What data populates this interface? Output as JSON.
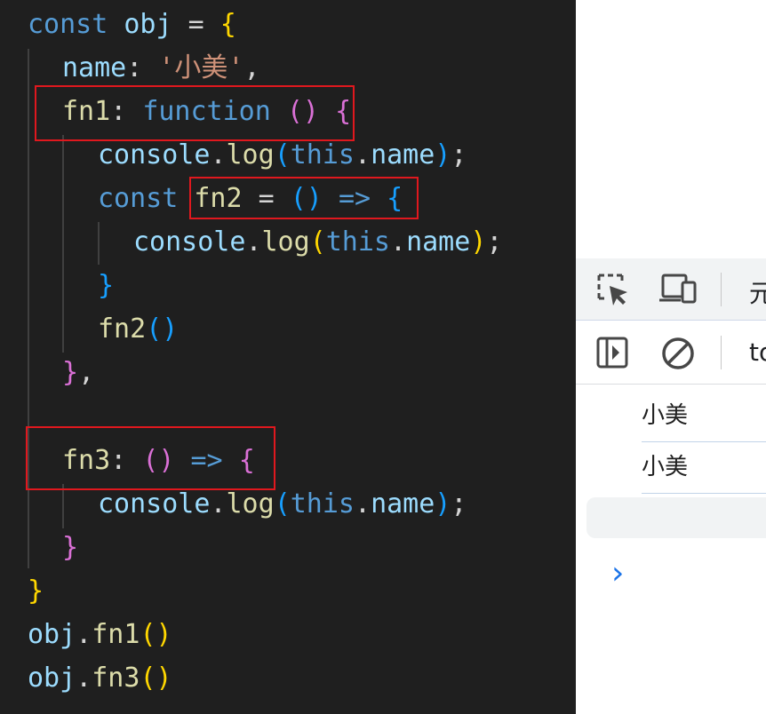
{
  "code": {
    "l1": {
      "kw": "const",
      "name": "obj",
      "eq": "=",
      "brace": "{"
    },
    "l2": {
      "key": "name",
      "colon": ":",
      "str": "'小美'",
      "comma": ","
    },
    "l3": {
      "key": "fn1",
      "colon": ":",
      "kw": "function",
      "parens": "()",
      "brace": "{"
    },
    "l4": {
      "obj": "console",
      "dot": ".",
      "method": "log",
      "open": "(",
      "kw": "this",
      "dot2": ".",
      "prop": "name",
      "close": ")",
      "semi": ";"
    },
    "l5": {
      "kw": "const",
      "name": "fn2",
      "eq": "=",
      "parens": "()",
      "arrow": "=>",
      "brace": "{"
    },
    "l6": {
      "obj": "console",
      "dot": ".",
      "method": "log",
      "open": "(",
      "kw": "this",
      "dot2": ".",
      "prop": "name",
      "close": ")",
      "semi": ";"
    },
    "l7": {
      "brace": "}"
    },
    "l8": {
      "call": "fn2",
      "parens": "()"
    },
    "l9": {
      "brace": "}",
      "comma": ","
    },
    "l11": {
      "key": "fn3",
      "colon": ":",
      "parens": "()",
      "arrow": "=>",
      "brace": "{"
    },
    "l12": {
      "obj": "console",
      "dot": ".",
      "method": "log",
      "open": "(",
      "kw": "this",
      "dot2": ".",
      "prop": "name",
      "close": ")",
      "semi": ";"
    },
    "l13": {
      "brace": "}"
    },
    "l14": {
      "brace": "}"
    },
    "l15": {
      "obj": "obj",
      "dot": ".",
      "method": "fn1",
      "parens": "()"
    },
    "l16": {
      "obj": "obj",
      "dot": ".",
      "method": "fn3",
      "parens": "()"
    }
  },
  "devtools": {
    "toolbar1": {
      "icons": [
        "inspect-element-icon",
        "device-toolbar-icon"
      ],
      "tab_partial": "元"
    },
    "toolbar2": {
      "icons": [
        "sidebar-toggle-icon",
        "clear-console-icon"
      ],
      "context_partial": "to"
    },
    "console": {
      "messages": [
        "小美",
        "小美"
      ],
      "prompt": "›"
    }
  },
  "colors": {
    "keyword": "#569cd6",
    "variable": "#9cdcfe",
    "function": "#dcdcaa",
    "string": "#ce9178",
    "bracket1": "#ffd700",
    "bracket2": "#da70d6",
    "bracket3": "#179fff",
    "highlight_box": "#e0181e"
  }
}
